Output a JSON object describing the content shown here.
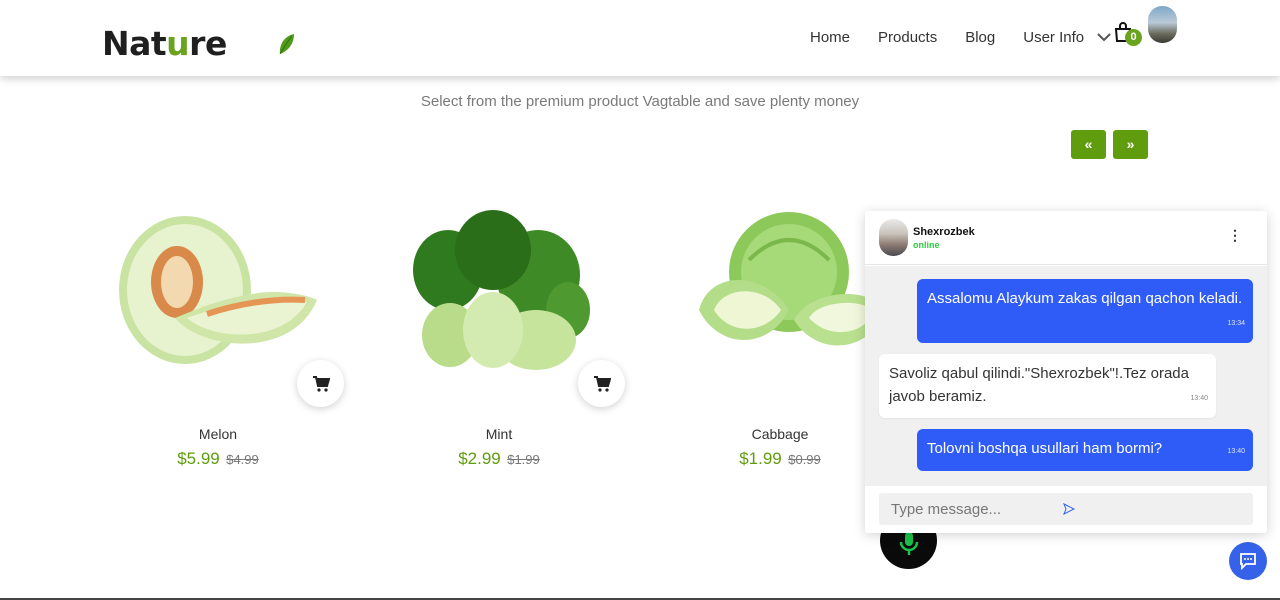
{
  "brand": {
    "name_pre": "Nat",
    "name_u": "u",
    "name_post": "re",
    "accent": "#6aa41e"
  },
  "nav": {
    "items": [
      "Home",
      "Products",
      "Blog",
      "User Info"
    ]
  },
  "cart": {
    "count": "0"
  },
  "hero": {
    "subtitle": "Select from the premium product Vagtable and save plenty money"
  },
  "slider": {
    "prev": "«",
    "next": "»"
  },
  "products": [
    {
      "name": "Melon",
      "price": "$5.99",
      "old_price": "$4.99"
    },
    {
      "name": "Mint",
      "price": "$2.99",
      "old_price": "$1.99"
    },
    {
      "name": "Cabbage",
      "price": "$1.99",
      "old_price": "$0.99"
    }
  ],
  "chat": {
    "contact_name": "Shexrozbek",
    "status": "online",
    "messages": [
      {
        "direction": "out",
        "text": "Assalomu Alaykum zakas qilgan qachon keladi.",
        "time": "13:34"
      },
      {
        "direction": "in",
        "text": "Savoliz qabul qilindi.\"Shexrozbek\"!.Tez orada javob beramiz.",
        "time": "13:40"
      },
      {
        "direction": "out",
        "text": "Tolovni boshqa usullari ham bormi?",
        "time": "13:40"
      }
    ],
    "input_placeholder": "Type message...",
    "outgoing_color": "#2f5cf6"
  }
}
